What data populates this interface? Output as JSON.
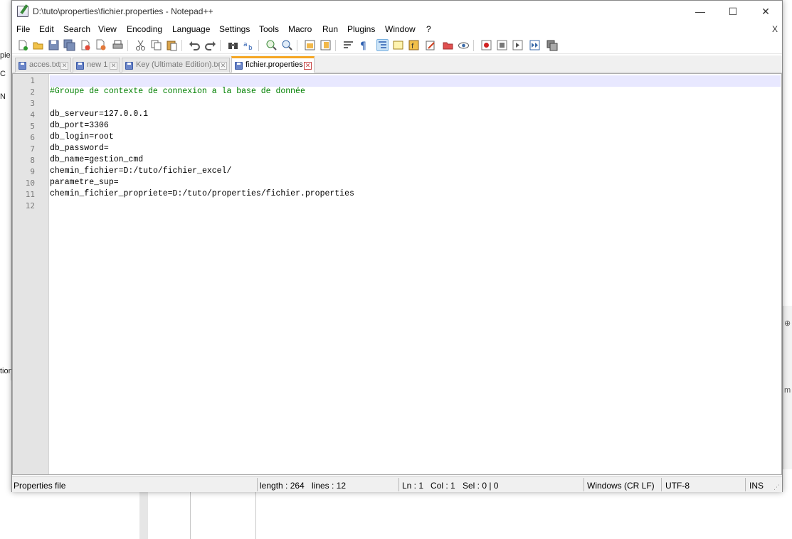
{
  "window": {
    "title": "D:\\tuto\\properties\\fichier.properties - Notepad++",
    "minimize_glyph": "—",
    "maximize_glyph": "☐",
    "close_glyph": "✕"
  },
  "menu": {
    "items": [
      "File",
      "Edit",
      "Search",
      "View",
      "Encoding",
      "Language",
      "Settings",
      "Tools",
      "Macro",
      "Run",
      "Plugins",
      "Window",
      "?"
    ],
    "close_label": "X"
  },
  "toolbar": {
    "icons": [
      "new-file-icon",
      "open-file-icon",
      "save-icon",
      "save-all-icon",
      "close-icon",
      "close-all-icon",
      "print-icon",
      "cut-icon",
      "copy-icon",
      "paste-icon",
      "undo-icon",
      "redo-icon",
      "find-icon",
      "replace-icon",
      "zoom-in-icon",
      "zoom-out-icon",
      "sync-vertical-icon",
      "sync-horizontal-icon",
      "word-wrap-icon",
      "show-all-chars-icon",
      "indent-guide-icon",
      "doc-map-icon",
      "function-list-icon",
      "folder-workspace-icon",
      "monitoring-icon",
      "record-macro-icon",
      "stop-macro-icon",
      "play-macro-icon",
      "run-macro-multiple-icon",
      "save-macro-icon"
    ]
  },
  "tabs": [
    {
      "label": "acces.txt",
      "active": false
    },
    {
      "label": "new 1",
      "active": false
    },
    {
      "label": "Key (Ultimate Edition).txt",
      "active": false
    },
    {
      "label": "fichier.properties",
      "active": true
    }
  ],
  "editor": {
    "line_numbers": [
      "1",
      "2",
      "3",
      "4",
      "5",
      "6",
      "7",
      "8",
      "9",
      "10",
      "11",
      "12"
    ],
    "lines": [
      {
        "text": "",
        "type": "blank"
      },
      {
        "text": "#Groupe de contexte de connexion a la base de donnée",
        "type": "comment"
      },
      {
        "text": "",
        "type": "blank"
      },
      {
        "key": "db_serveur",
        "value": "127.0.0.1",
        "type": "prop"
      },
      {
        "key": "db_port",
        "value": "3306",
        "type": "prop"
      },
      {
        "key": "db_login",
        "value": "root",
        "type": "prop"
      },
      {
        "key": "db_password",
        "value": "",
        "type": "prop"
      },
      {
        "key": "db_name",
        "value": "gestion_cmd",
        "type": "prop"
      },
      {
        "key": "chemin_fichier",
        "value": "D:/tuto/fichier_excel/",
        "type": "prop"
      },
      {
        "key": "parametre_sup",
        "value": "",
        "type": "prop"
      },
      {
        "key": "chemin_fichier_propriete",
        "value": "D:/tuto/properties/fichier.properties",
        "type": "prop"
      },
      {
        "text": "",
        "type": "blank"
      }
    ]
  },
  "status": {
    "file_type": "Properties file",
    "length": "length : 264",
    "lines": "lines : 12",
    "ln": "Ln : 1",
    "col": "Col : 1",
    "sel": "Sel : 0 | 0",
    "eol": "Windows (CR LF)",
    "encoding": "UTF-8",
    "mode": "INS"
  },
  "background": {
    "left_fragments": [
      "pie",
      "C",
      "N",
      "tion"
    ],
    "right_fragments": [
      "⊕",
      "m"
    ]
  },
  "colors": {
    "comment": "#008000",
    "caret_line": "#e8e8ff",
    "active_tab_accent": "#f5a623",
    "gutter": "#e4e4e4"
  }
}
